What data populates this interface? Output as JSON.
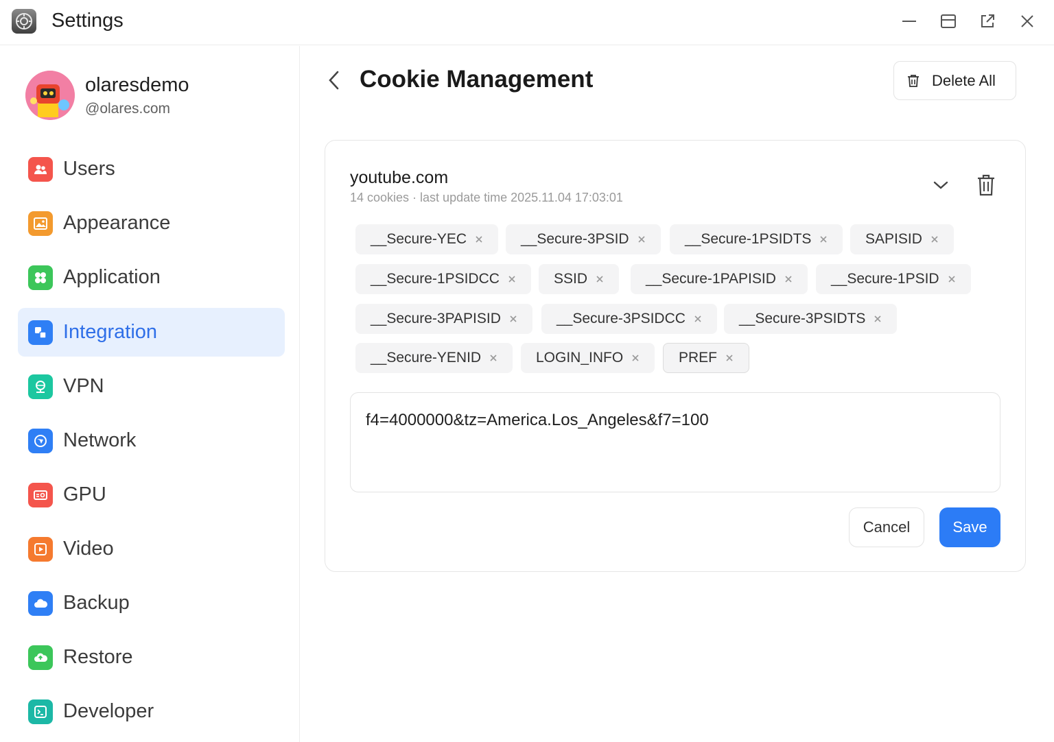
{
  "window": {
    "title": "Settings"
  },
  "user": {
    "name": "olaresdemo",
    "domain": "@olares.com"
  },
  "sidebar": {
    "items": [
      {
        "label": "Users",
        "icon": "users-icon",
        "color": "#f4554c"
      },
      {
        "label": "Appearance",
        "icon": "appearance-icon",
        "color": "#f39a2e"
      },
      {
        "label": "Application",
        "icon": "application-icon",
        "color": "#3cc65a"
      },
      {
        "label": "Integration",
        "icon": "integration-icon",
        "color": "#2f7ff5",
        "active": true
      },
      {
        "label": "VPN",
        "icon": "vpn-icon",
        "color": "#1cc7a0"
      },
      {
        "label": "Network",
        "icon": "network-icon",
        "color": "#2f7ff5"
      },
      {
        "label": "GPU",
        "icon": "gpu-icon",
        "color": "#f4554c"
      },
      {
        "label": "Video",
        "icon": "video-icon",
        "color": "#f57a2f"
      },
      {
        "label": "Backup",
        "icon": "backup-icon",
        "color": "#2f7ff5"
      },
      {
        "label": "Restore",
        "icon": "restore-icon",
        "color": "#3cc65a"
      },
      {
        "label": "Developer",
        "icon": "developer-icon",
        "color": "#1cb8a6"
      }
    ]
  },
  "header": {
    "title": "Cookie Management",
    "delete_all_label": "Delete All"
  },
  "cookie_group": {
    "domain": "youtube.com",
    "meta": "14 cookies · last update time 2025.11.04 17:03:01",
    "cookies": [
      "__Secure-YEC",
      "__Secure-3PSID",
      "__Secure-1PSIDTS",
      "SAPISID",
      "__Secure-1PSIDCC",
      "SSID",
      "__Secure-1PAPISID",
      "__Secure-1PSID",
      "__Secure-3PAPISID",
      "__Secure-3PSIDCC",
      "__Secure-3PSIDTS",
      "__Secure-YENID",
      "LOGIN_INFO",
      "PREF"
    ],
    "selected_cookie": "PREF",
    "value": "f4=4000000&tz=America.Los_Angeles&f7=100",
    "cancel_label": "Cancel",
    "save_label": "Save"
  },
  "colors": {
    "accent": "#2c7cf6",
    "active_bg": "#e7f0fe"
  }
}
